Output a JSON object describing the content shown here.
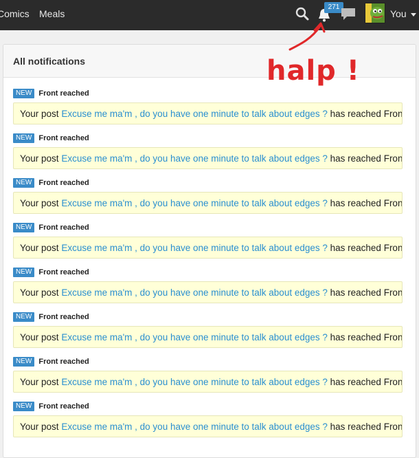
{
  "nav": {
    "links": [
      "Comics",
      "Meals"
    ],
    "notification_count": "271",
    "user_label": "You"
  },
  "panel": {
    "title": "All notifications"
  },
  "notifications": [
    {
      "badge": "NEW",
      "type": "Front reached",
      "prefix": "Your post",
      "link": "Excuse me ma'm , do you have one minute to talk about edges ?",
      "suffix": "has reached Front!"
    },
    {
      "badge": "NEW",
      "type": "Front reached",
      "prefix": "Your post",
      "link": "Excuse me ma'm , do you have one minute to talk about edges ?",
      "suffix": "has reached Front!"
    },
    {
      "badge": "NEW",
      "type": "Front reached",
      "prefix": "Your post",
      "link": "Excuse me ma'm , do you have one minute to talk about edges ?",
      "suffix": "has reached Front!"
    },
    {
      "badge": "NEW",
      "type": "Front reached",
      "prefix": "Your post",
      "link": "Excuse me ma'm , do you have one minute to talk about edges ?",
      "suffix": "has reached Front!"
    },
    {
      "badge": "NEW",
      "type": "Front reached",
      "prefix": "Your post",
      "link": "Excuse me ma'm , do you have one minute to talk about edges ?",
      "suffix": "has reached Front!"
    },
    {
      "badge": "NEW",
      "type": "Front reached",
      "prefix": "Your post",
      "link": "Excuse me ma'm , do you have one minute to talk about edges ?",
      "suffix": "has reached Front!"
    },
    {
      "badge": "NEW",
      "type": "Front reached",
      "prefix": "Your post",
      "link": "Excuse me ma'm , do you have one minute to talk about edges ?",
      "suffix": "has reached Front!"
    },
    {
      "badge": "NEW",
      "type": "Front reached",
      "prefix": "Your post",
      "link": "Excuse me ma'm , do you have one minute to talk about edges ?",
      "suffix": "has reached Front!"
    }
  ],
  "annotation": {
    "text": "halp !",
    "color": "#e0282a"
  },
  "colors": {
    "navbar": "#2b2b2b",
    "badge_blue": "#3a8bc8",
    "link_blue": "#2a8fd0",
    "notification_bg": "#ffffd8"
  }
}
